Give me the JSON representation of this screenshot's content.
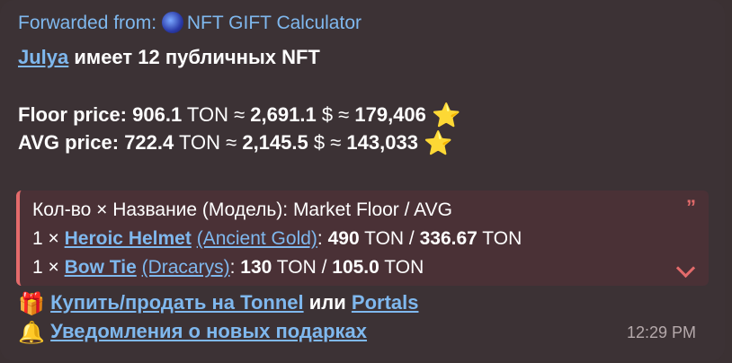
{
  "forward": {
    "prefix": "Forwarded from:",
    "source": "NFT GIFT Calculator"
  },
  "owner": {
    "name": "Julya",
    "text": "имеет 12 публичных NFT"
  },
  "floor": {
    "label": "Floor price:",
    "ton": "906.1",
    "ton_unit": "TON ≈",
    "usd": "2,691.1",
    "usd_unit": "$ ≈",
    "stars": "179,406",
    "star_icon": "⭐"
  },
  "avg": {
    "label": "AVG price:",
    "ton": "722.4",
    "ton_unit": "TON ≈",
    "usd": "2,145.5",
    "usd_unit": "$ ≈",
    "stars": "143,033",
    "star_icon": "⭐"
  },
  "quote": {
    "header": "Кол-во × Название (Модель): Market Floor / AVG",
    "quote_mark": "”",
    "accent_color": "#e36b6b",
    "items": [
      {
        "count": "1 ×",
        "name": "Heroic Helmet",
        "model": "(Ancient Gold)",
        "floor": "490",
        "avg": "336.67"
      },
      {
        "count": "1 ×",
        "name": "Bow Tie",
        "model": "(Dracarys)",
        "floor": "130",
        "avg": "105.0"
      }
    ],
    "unit_sep": "TON /",
    "unit_end": "TON"
  },
  "actions": {
    "gift_emoji": "🎁",
    "buy_sell": "Купить/продать на Tonnel",
    "or": "или",
    "portals": "Portals",
    "bell_emoji": "🔔",
    "notify": "Уведомления о новых подарках"
  },
  "time": "12:29 PM",
  "colors": {
    "link": "#7fb8ee",
    "bubble_bg": "#3c3235"
  }
}
